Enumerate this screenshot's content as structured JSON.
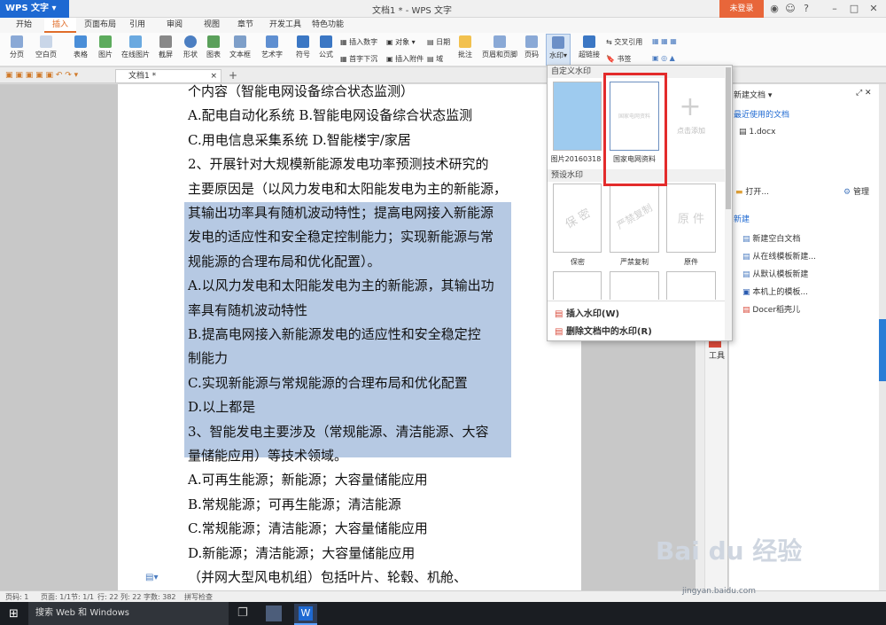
{
  "app": {
    "name": "WPS 文字",
    "title": "文档1 * - WPS 文字",
    "login": "未登录"
  },
  "tabs": [
    "开始",
    "插入",
    "页面布局",
    "引用",
    "审阅",
    "视图",
    "章节",
    "开发工具",
    "特色功能"
  ],
  "ribbon": {
    "buttons": [
      "分页",
      "空白页",
      "表格",
      "图片",
      "在线图片",
      "截屏",
      "形状",
      "图表",
      "文本框",
      "艺术字",
      "符号",
      "公式",
      "批注",
      "页眉和页脚",
      "页码",
      "水印",
      "超链接"
    ],
    "small": [
      "插入数字",
      "对象",
      "日期",
      "首字下沉",
      "插入附件",
      "域",
      "交叉引用",
      "书签"
    ]
  },
  "doc_tab": "文档1 *",
  "document": {
    "lines": [
      "个内容（智能电网设备综合状态监测）",
      "A.配电自动化系统   B.智能电网设备综合状态监测",
      "C.用电信息采集系统  D.智能楼宇/家居",
      "2、开展针对大规模新能源发电功率预测技术研究的",
      "主要原因是（以风力发电和太阳能发电为主的新能源，",
      "其输出功率具有随机波动特性；提高电网接入新能源",
      "发电的适应性和安全稳定控制能力；实现新能源与常",
      "规能源的合理布局和优化配置）。",
      "A.以风力发电和太阳能发电为主的新能源，其输出功",
      "率具有随机波动特性",
      "B.提高电网接入新能源发电的适应性和安全稳定控",
      "制能力",
      "C.实现新能源与常规能源的合理布局和优化配置",
      "D.以上都是",
      "3、智能发电主要涉及（常规能源、清洁能源、大容",
      "量储能应用）等技术领域。",
      "A.可再生能源；新能源；大容量储能应用",
      "B.常规能源；可再生能源；清洁能源",
      "C.常规能源；清洁能源；大容量储能应用",
      "D.新能源；清洁能源；大容量储能应用",
      "（并网大型风电机组）包括叶片、轮毂、机舱、"
    ]
  },
  "dropdown": {
    "custom_header": "自定义水印",
    "custom_items": [
      "图片20160318",
      "国家电网资料"
    ],
    "custom_item_text": "国家电网资料",
    "add_label": "点击添加",
    "preset_header": "预设水印",
    "preset_items": [
      {
        "text": "保 密",
        "label": "保密"
      },
      {
        "text": "严禁复制",
        "label": "严禁复制"
      },
      {
        "text": "原 件",
        "label": "原件"
      }
    ],
    "insert": "插入水印(W)",
    "delete": "删除文档中的水印(R)"
  },
  "taskpane": {
    "new_doc": "新建文档",
    "recent_header": "最近使用的文档",
    "recent": [
      "1.docx"
    ],
    "open": "打开...",
    "manage": "管理",
    "new_header": "新建",
    "new_items": [
      "新建空白文档",
      "从在线模板新建...",
      "从默认模板新建",
      "本机上的模板...",
      "Docer稻壳儿"
    ]
  },
  "toolstrip": {
    "label": "工具"
  },
  "status": {
    "items": [
      "页码: 1",
      "页面: 1/1",
      "节: 1/1",
      "行: 22",
      "列: 22",
      "字数: 382",
      "拼写检查"
    ]
  },
  "taskbar": {
    "search": "搜索 Web 和 Windows"
  },
  "watermark": {
    "text": "Bai du 经验",
    "url": "jingyan.baidu.com"
  },
  "colors": {
    "accent": "#e06d2a",
    "brand": "#1e69d2",
    "highlight": "#e32b2b"
  }
}
